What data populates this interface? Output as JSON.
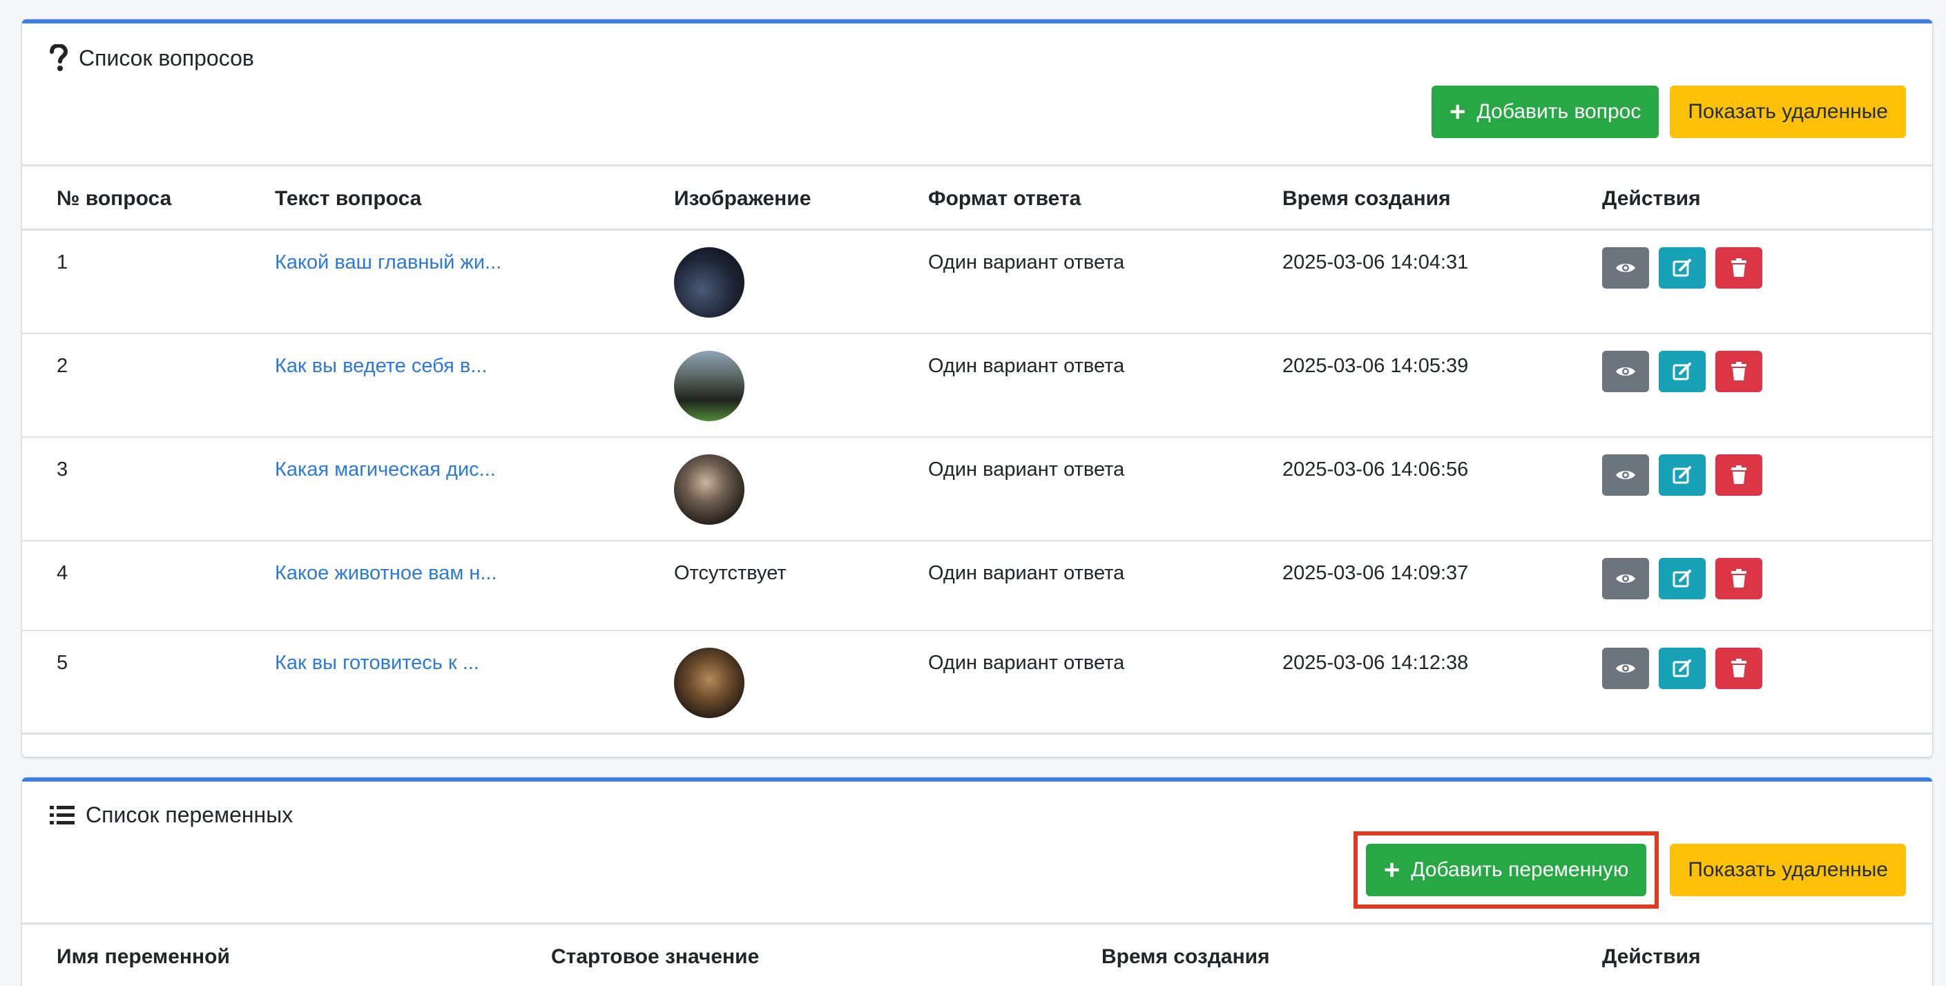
{
  "questions_card": {
    "title": "Список вопросов",
    "add_button": "Добавить вопрос",
    "show_deleted_button": "Показать удаленные",
    "columns": [
      "№ вопроса",
      "Текст вопроса",
      "Изображение",
      "Формат ответа",
      "Время создания",
      "Действия"
    ],
    "rows": [
      {
        "number": "1",
        "text": "Какой ваш главный жи...",
        "image": "",
        "format": "Один вариант ответа",
        "created": "2025-03-06 14:04:31"
      },
      {
        "number": "2",
        "text": "Как вы ведете себя в...",
        "image": "",
        "format": "Один вариант ответа",
        "created": "2025-03-06 14:05:39"
      },
      {
        "number": "3",
        "text": "Какая магическая дис...",
        "image": "",
        "format": "Один вариант ответа",
        "created": "2025-03-06 14:06:56"
      },
      {
        "number": "4",
        "text": "Какое животное вам н...",
        "image": "Отсутствует",
        "format": "Один вариант ответа",
        "created": "2025-03-06 14:09:37"
      },
      {
        "number": "5",
        "text": "Как вы готовитесь к ...",
        "image": "",
        "format": "Один вариант ответа",
        "created": "2025-03-06 14:12:38"
      }
    ]
  },
  "variables_card": {
    "title": "Список переменных",
    "add_button": "Добавить переменную",
    "show_deleted_button": "Показать удаленные",
    "columns": [
      "Имя переменной",
      "Стартовое значение",
      "Время создания",
      "Действия"
    ]
  },
  "icons": {
    "questions_title": "question-mark-icon",
    "variables_title": "list-icon",
    "view": "eye-icon",
    "edit": "edit-icon",
    "delete": "trash-icon"
  },
  "colors": {
    "accent": "#3d7fe0",
    "success": "#28a745",
    "warning": "#ffc107",
    "view": "#6c757d",
    "edit": "#17a2b8",
    "delete": "#dc3545",
    "link": "#2c7ad6",
    "highlight": "#e03a22"
  }
}
